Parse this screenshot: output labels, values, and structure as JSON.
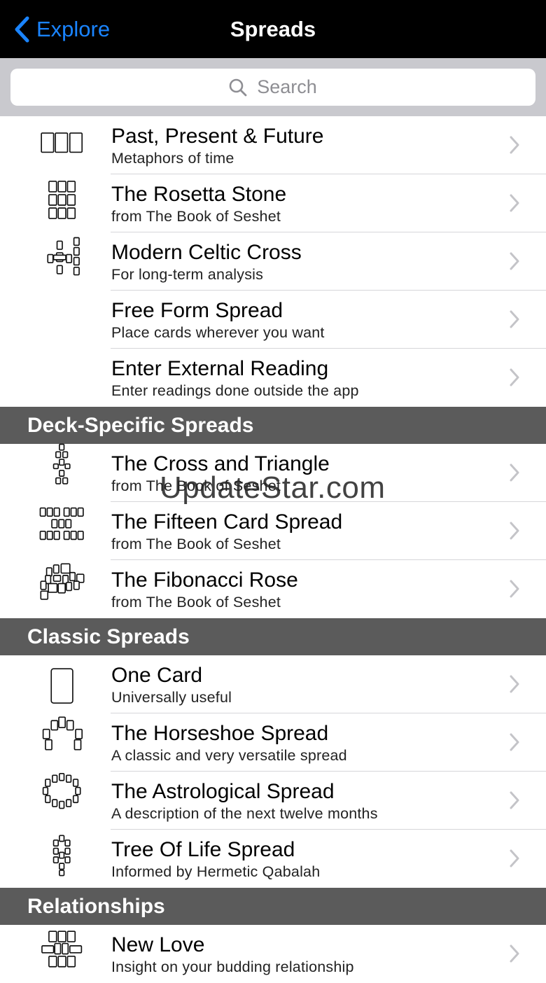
{
  "nav": {
    "back_label": "Explore",
    "title": "Spreads"
  },
  "search": {
    "placeholder": "Search"
  },
  "groups": [
    {
      "header": "",
      "rows": [
        {
          "title": "Past, Present & Future",
          "subtitle": "Metaphors of time",
          "icon": "three-card-spread-icon"
        },
        {
          "title": "The Rosetta Stone",
          "subtitle": "from The Book of Seshet",
          "icon": "rosetta-stone-spread-icon"
        },
        {
          "title": "Modern Celtic Cross",
          "subtitle": "For long-term analysis",
          "icon": "celtic-cross-spread-icon"
        },
        {
          "title": "Free Form Spread",
          "subtitle": "Place cards wherever you want",
          "icon": ""
        },
        {
          "title": "Enter External Reading",
          "subtitle": "Enter readings done outside the app",
          "icon": ""
        }
      ]
    },
    {
      "header": "Deck-Specific Spreads",
      "rows": [
        {
          "title": "The Cross and Triangle",
          "subtitle": "from The Book of Seshet",
          "icon": "cross-and-triangle-spread-icon"
        },
        {
          "title": "The Fifteen Card Spread",
          "subtitle": "from The Book of Seshet",
          "icon": "fifteen-card-spread-icon"
        },
        {
          "title": "The Fibonacci Rose",
          "subtitle": "from The Book of Seshet",
          "icon": "fibonacci-rose-spread-icon"
        }
      ]
    },
    {
      "header": "Classic Spreads",
      "rows": [
        {
          "title": "One Card",
          "subtitle": "Universally useful",
          "icon": "one-card-spread-icon"
        },
        {
          "title": "The Horseshoe Spread",
          "subtitle": "A classic and very versatile spread",
          "icon": "horseshoe-spread-icon"
        },
        {
          "title": "The Astrological Spread",
          "subtitle": "A description of the next twelve months",
          "icon": "astrological-spread-icon"
        },
        {
          "title": "Tree Of Life Spread",
          "subtitle": "Informed by Hermetic Qabalah",
          "icon": "tree-of-life-spread-icon"
        }
      ]
    },
    {
      "header": "Relationships",
      "rows": [
        {
          "title": "New Love",
          "subtitle": "Insight on your budding relationship",
          "icon": "new-love-spread-icon"
        }
      ]
    }
  ],
  "watermark": "UpdateStar.com"
}
